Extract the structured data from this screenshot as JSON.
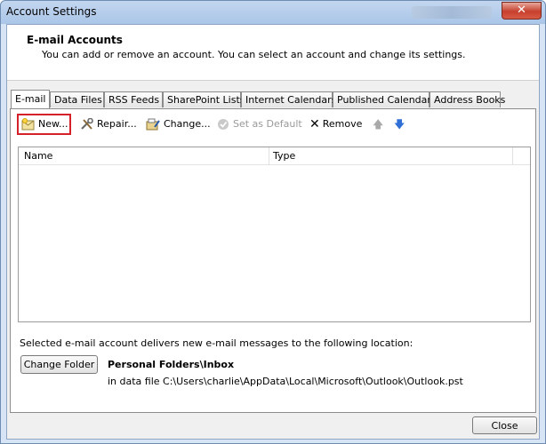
{
  "window": {
    "title": "Account Settings",
    "close_glyph": "✕"
  },
  "header": {
    "title": "E-mail Accounts",
    "subtitle": "You can add or remove an account. You can select an account and change its settings."
  },
  "tabs": [
    {
      "label": "E-mail",
      "active": true
    },
    {
      "label": "Data Files"
    },
    {
      "label": "RSS Feeds"
    },
    {
      "label": "SharePoint Lists"
    },
    {
      "label": "Internet Calendars"
    },
    {
      "label": "Published Calendars"
    },
    {
      "label": "Address Books"
    }
  ],
  "toolbar": {
    "new_label": "New...",
    "repair_label": "Repair...",
    "change_label": "Change...",
    "set_default_label": "Set as Default",
    "remove_label": "Remove",
    "remove_glyph": "✕",
    "move_up_glyph": "🡅",
    "move_down_glyph": "🡇"
  },
  "list": {
    "columns": [
      "Name",
      "Type"
    ]
  },
  "delivery": {
    "text": "Selected e-mail account delivers new e-mail messages to the following location:",
    "change_folder_label": "Change Folder",
    "folder_name": "Personal Folders\\Inbox",
    "folder_path": "in data file C:\\Users\\charlie\\AppData\\Local\\Microsoft\\Outlook\\Outlook.pst"
  },
  "footer": {
    "close_label": "Close"
  },
  "colors": {
    "highlight_border": "#d4212a",
    "title_bar": "#aac6e8",
    "close_button": "#c7402d"
  }
}
